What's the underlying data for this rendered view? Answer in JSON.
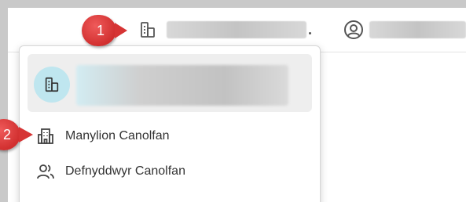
{
  "callouts": [
    {
      "number": "1"
    },
    {
      "number": "2"
    }
  ],
  "colors": {
    "callout": "#e03a3a",
    "avatar_bg": "#bfe6ef",
    "icon_stroke": "#555555",
    "text": "#333333"
  },
  "topbar": {
    "org_icon": "building-icon",
    "user_icon": "user-circle-icon"
  },
  "dropdown": {
    "header_icon": "building-icon",
    "items": [
      {
        "label": "Manylion Canolfan",
        "icon": "office-building-icon"
      },
      {
        "label": "Defnyddwyr Canolfan",
        "icon": "users-icon"
      }
    ]
  }
}
